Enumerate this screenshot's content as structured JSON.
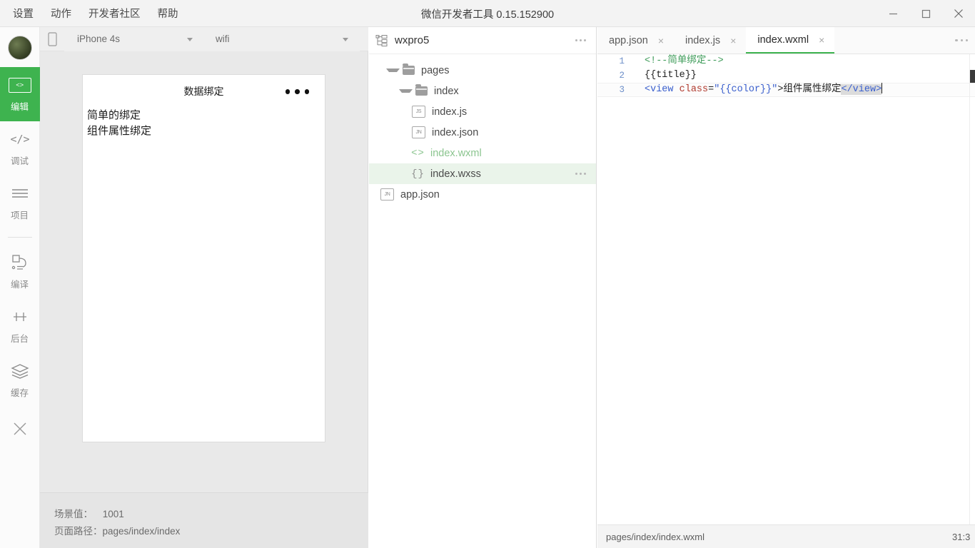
{
  "window": {
    "title": "微信开发者工具 0.15.152900",
    "menu": [
      "设置",
      "动作",
      "开发者社区",
      "帮助"
    ],
    "controls": {
      "minimize": "minimize-icon",
      "maximize": "maximize-icon",
      "close": "close-icon"
    }
  },
  "rail": {
    "items": [
      {
        "label": "编辑",
        "icon": "code-box-icon",
        "active": true
      },
      {
        "label": "调试",
        "icon": "angle-brackets-icon",
        "active": false
      },
      {
        "label": "项目",
        "icon": "lines-icon",
        "active": false
      },
      {
        "label": "编译",
        "icon": "compile-icon",
        "active": false
      },
      {
        "label": "后台",
        "icon": "background-icon",
        "active": false
      },
      {
        "label": "缓存",
        "icon": "layers-icon",
        "active": false
      }
    ],
    "close_label": "close-icon",
    "avatar": "user-avatar"
  },
  "simulator": {
    "toolbar": {
      "phone_icon": "phone-icon",
      "device": "iPhone 4s",
      "network": "wifi"
    },
    "page": {
      "title": "数据绑定",
      "more_icon": "more-dots-icon",
      "lines": [
        "简单的绑定",
        "组件属性绑定"
      ]
    },
    "footer": {
      "scene_label": "场景值：",
      "scene_value": "1001",
      "path_label": "页面路径：",
      "path_value": "pages/index/index"
    }
  },
  "filetree": {
    "project_icon": "project-tree-icon",
    "project_name": "wxpro5",
    "more_icon": "more-dots-icon",
    "nodes": [
      {
        "name": "pages",
        "type": "folder",
        "depth": 0,
        "expanded": true,
        "selected": false
      },
      {
        "name": "index",
        "type": "folder",
        "depth": 1,
        "expanded": true,
        "selected": false
      },
      {
        "name": "index.js",
        "type": "js",
        "depth": 2,
        "selected": false
      },
      {
        "name": "index.json",
        "type": "jn",
        "depth": 2,
        "selected": false
      },
      {
        "name": "index.wxml",
        "type": "wxml",
        "depth": 2,
        "selected": false
      },
      {
        "name": "index.wxss",
        "type": "wxss",
        "depth": 2,
        "selected": true
      },
      {
        "name": "app.json",
        "type": "jn",
        "depth": 0,
        "selected": false
      }
    ],
    "row_more_icon": "more-dots-icon",
    "cursor": "mouse-pointer"
  },
  "editor": {
    "tabs": [
      {
        "label": "app.json",
        "active": false
      },
      {
        "label": "index.js",
        "active": false
      },
      {
        "label": "index.wxml",
        "active": true
      }
    ],
    "tab_close_icon": "×",
    "tabs_more_icon": "more-dots-icon",
    "lines": [
      {
        "number": "1",
        "text": "<!--简单绑定-->"
      },
      {
        "number": "2",
        "text": "{{title}}"
      },
      {
        "number": "3",
        "text": "<view class=\"{{color}}\">组件属性绑定</view>"
      }
    ],
    "status": {
      "file_path": "pages/index/index.wxml",
      "cursor_position": "31:3"
    }
  },
  "colors": {
    "accent_green": "#3eb34f",
    "wxml_green": "#8bc58f",
    "tag_blue": "#3a5fcd",
    "attr_red": "#b03a2e",
    "comment_green": "#3f9c5a",
    "gutter_blue": "#6d8fc9",
    "selected_row": "#eaf4ea"
  }
}
